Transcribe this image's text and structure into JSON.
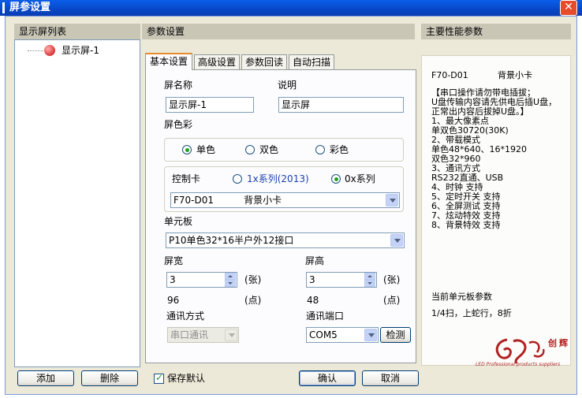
{
  "window": {
    "title": "屏参设置",
    "close_glyph": "✕"
  },
  "left_panel": {
    "header": "显示屏列表",
    "items": [
      {
        "label": "显示屏-1",
        "status_color": "#f05050"
      }
    ],
    "add_button": "添加",
    "delete_button": "删除"
  },
  "middle_panel": {
    "header": "参数设置",
    "tabs": [
      "基本设置",
      "高级设置",
      "参数回读",
      "自动扫描"
    ],
    "active_tab": "基本设置",
    "screen_name_label": "屏名称",
    "screen_name_value": "显示屏-1",
    "description_label": "说明",
    "description_value": "显示屏",
    "color_label": "屏色彩",
    "color_options": [
      "单色",
      "双色",
      "彩色"
    ],
    "color_selected": "单色",
    "controller_label": "控制卡",
    "controller_series": [
      "1x系列(2013)",
      "0x系列"
    ],
    "controller_selected": "0x系列",
    "controller_card_value": "F70-D01          背景小卡",
    "unit_board_label": "单元板",
    "unit_board_value": "P10单色32*16半户外12接口",
    "width_label": "屏宽",
    "width_value": "3",
    "width_unit": "(张)",
    "width_pixels": "96",
    "width_pixels_unit": "(点)",
    "height_label": "屏高",
    "height_value": "3",
    "height_unit": "(张)",
    "height_pixels": "48",
    "height_pixels_unit": "(点)",
    "comm_mode_label": "通讯方式",
    "comm_mode_value": "串口通讯",
    "comm_port_label": "通讯端口",
    "comm_port_value": "COM5",
    "detect_button": "检测"
  },
  "right_panel": {
    "header": "主要性能参数",
    "model": "F70-D01",
    "card_type": "背景小卡",
    "details": [
      "【串口操作请勿带电插拔；",
      "U盘传输内容请先供电后插U盘，",
      "正常出内容后拔掉U盘。】",
      "1、最大像素点",
      "单双色30720(30K)",
      "2、带载模式",
      "单色48*640、16*1920",
      "双色32*960",
      "3、通讯方式",
      "RS232直通、USB",
      "4、时钟 支持",
      "5、定时开关 支持",
      "6、全屏测试 支持",
      "7、炫动特效 支持",
      "8、背景特效 支持"
    ],
    "unit_board_params_label": "当前单元板参数",
    "unit_board_params_value": "1/4扫，上蛇行，8折",
    "logo_text": "LED Professional products suppliers"
  },
  "footer": {
    "save_default_label": "保存默认",
    "save_default_checked": true,
    "ok_button": "确认",
    "cancel_button": "取消"
  }
}
